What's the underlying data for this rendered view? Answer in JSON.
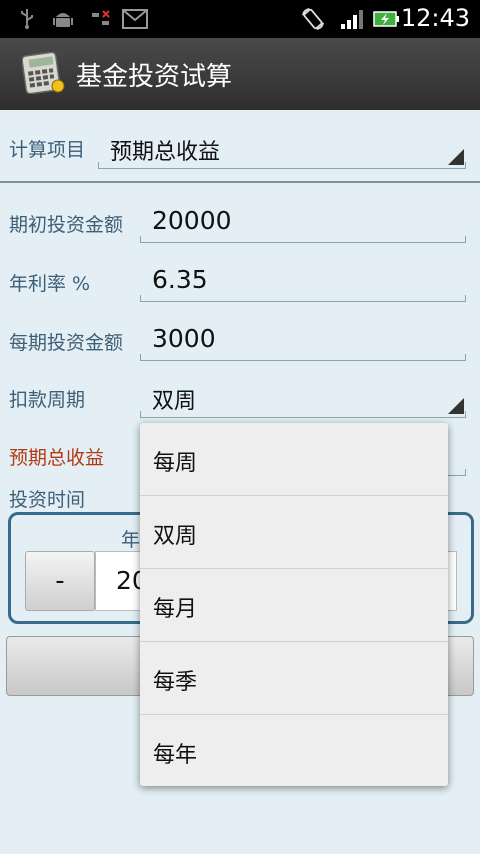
{
  "status_bar": {
    "time": "12:43",
    "icons": [
      "usb-icon",
      "android-debug-icon",
      "data-sync-icon",
      "gmail-icon",
      "screen-rotate-icon",
      "signal-icon",
      "battery-charging-icon"
    ]
  },
  "app_bar": {
    "title": "基金投资试算",
    "icon": "calculator-icon"
  },
  "form": {
    "calc_item_label": "计算项目",
    "calc_item_value": "预期总收益",
    "initial_amount_label": "期初投资金额",
    "initial_amount_value": "20000",
    "annual_rate_label": "年利率 %",
    "annual_rate_value": "6.35",
    "period_amount_label": "每期投资金额",
    "period_amount_value": "3000",
    "debit_cycle_label": "扣款周期",
    "debit_cycle_value": "双周",
    "expected_total_label": "预期总收益",
    "invest_time_label": "投资时间",
    "year_header": "年",
    "minus_label": "-",
    "year_value_partial": "20"
  },
  "dropdown": {
    "options": [
      "每周",
      "双周",
      "每月",
      "每季",
      "每年"
    ]
  },
  "colors": {
    "background": "#e3eff4",
    "label": "#3e5f78",
    "result_label": "#b33a10",
    "title_bar": "#3a3a3a"
  }
}
